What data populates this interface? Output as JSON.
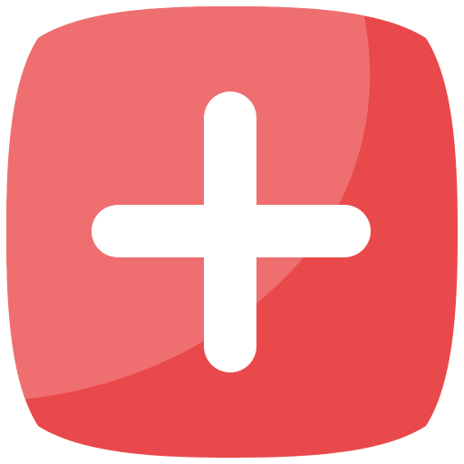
{
  "icon": {
    "name": "add-icon",
    "symbol": "plus",
    "colors": {
      "base": "#E9494A",
      "highlight": "#EF6F70",
      "glyph": "#FFFFFF",
      "background": "#FFFFFF"
    }
  }
}
